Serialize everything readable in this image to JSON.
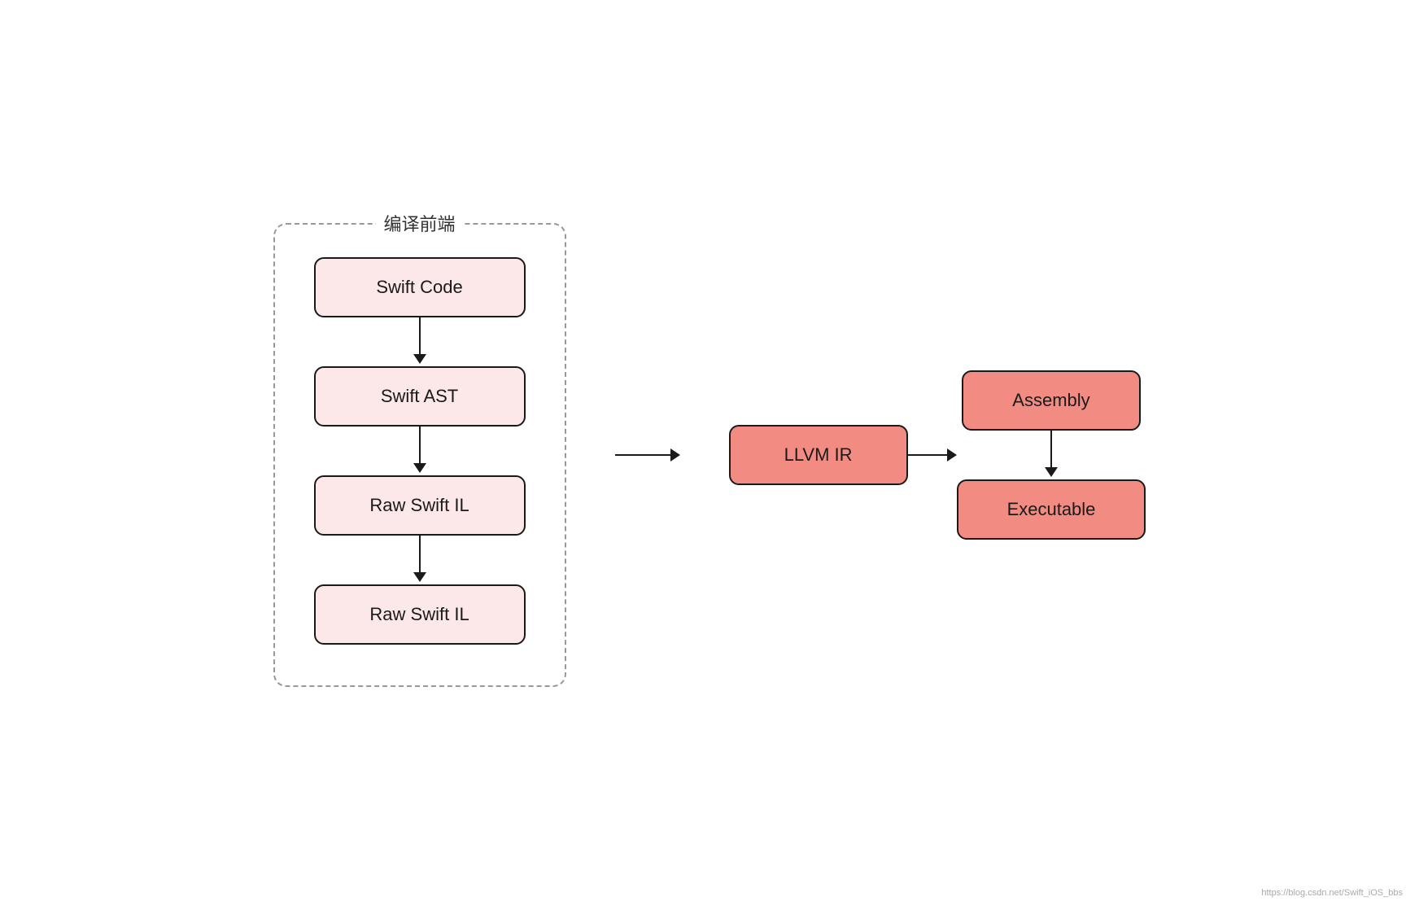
{
  "diagram": {
    "frontend_label": "编译前端",
    "frontend_nodes": [
      {
        "id": "swift-code",
        "label": "Swift Code"
      },
      {
        "id": "swift-ast",
        "label": "Swift AST"
      },
      {
        "id": "raw-swift-il-1",
        "label": "Raw Swift IL"
      },
      {
        "id": "raw-swift-il-2",
        "label": "Raw Swift IL"
      }
    ],
    "backend_nodes": {
      "llvm_ir": "LLVM IR",
      "assembly": "Assembly",
      "executable": "Executable"
    },
    "watermark": "https://blog.csdn.net/Swift_iOS_bbs"
  }
}
